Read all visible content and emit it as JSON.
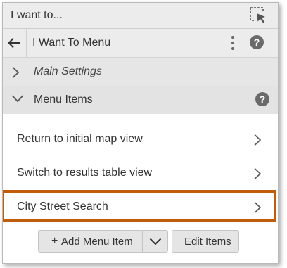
{
  "window": {
    "title": "I want to..."
  },
  "navbar": {
    "title": "I Want To Menu"
  },
  "sections": {
    "main_settings": {
      "label": "Main Settings",
      "expanded": false
    },
    "menu_items": {
      "label": "Menu Items",
      "expanded": true
    }
  },
  "menu_items": [
    {
      "label": "Return to initial map view"
    },
    {
      "label": "Switch to results table view"
    },
    {
      "label": "City Street Search",
      "highlighted": true
    }
  ],
  "buttons": {
    "add_plus": "+",
    "add_label": "Add Menu Item",
    "edit_label": "Edit Items"
  },
  "help_glyph": "?",
  "icons": {
    "cursor": "select-pointer-icon",
    "back": "arrow-left-icon",
    "more": "kebab-menu-icon",
    "help": "help-circle-icon",
    "collapsed": "chevron-right-icon",
    "expanded": "chevron-down-icon",
    "item_arrow": "chevron-right-icon",
    "dropdown": "chevron-down-icon"
  },
  "colors": {
    "highlight_border": "#c05d0a",
    "header_bg": "#ececec",
    "help_badge": "#6a6a6a"
  }
}
